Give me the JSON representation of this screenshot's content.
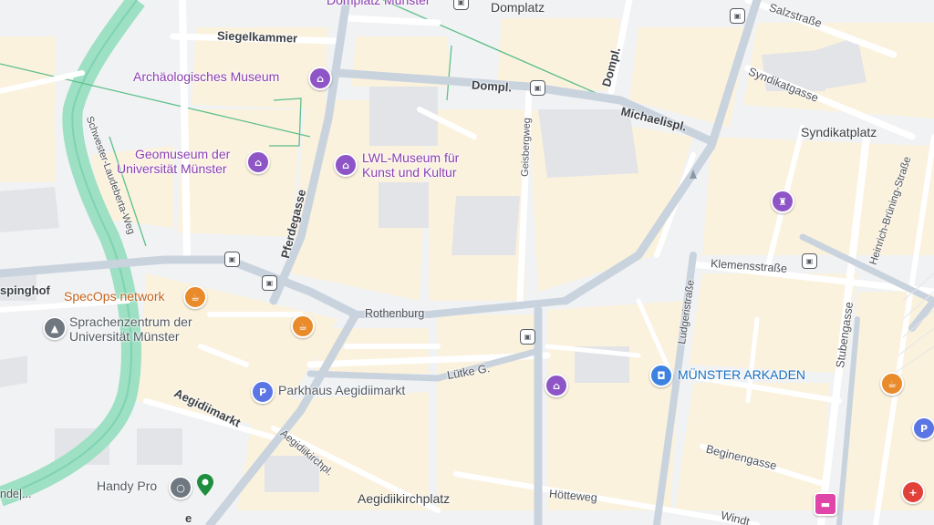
{
  "map": {
    "colors": {
      "background": "#f1f2f4",
      "block": "#fbf2de",
      "building": "#e3e5e8",
      "road": "#ffffff",
      "major_road": "#c9d3de",
      "river": "#9de0c4",
      "path": "#5cbf8a",
      "poi_purple": "#8e55c7",
      "poi_orange": "#e98a2b",
      "poi_blue": "#3d82e0"
    },
    "pois": {
      "domplatz_muenster": "Domplatz Münster",
      "domplatz": "Domplatz",
      "archaeologisches_museum": "Archäologisches Museum",
      "geomuseum_line1": "Geomuseum der",
      "geomuseum_line2": "Universität Münster",
      "lwl_line1": "LWL-Museum für",
      "lwl_line2": "Kunst und Kultur",
      "syndikatplatz": "Syndikatplatz",
      "specops": "SpecOps network",
      "sprachen_line1": "Sprachenzentrum der",
      "sprachen_line2": "Universität Münster",
      "parkhaus": "Parkhaus Aegidiimarkt",
      "muenster_arkaden": "MÜNSTER ARKADEN",
      "handy_pro": "Handy Pro",
      "aegidiikirchplatz": "Aegidiikirchplatz"
    },
    "streets": {
      "siegelkammer": "Siegelkammer",
      "dompl_1": "Dompl.",
      "dompl_2": "Dompl.",
      "michaelispl": "Michaelispl.",
      "salzstrasse": "Salzstraße",
      "syndikatgasse": "Syndikatgasse",
      "schwester": "Schwester-Laudeberta-Weg",
      "geisbergweg": "Geisbergweg",
      "pferdegasse": "Pferdegasse",
      "heinrich": "Heinrich-Brüning-Straße",
      "klemensstrasse": "Klemensstraße",
      "spinghof": "spinghof",
      "rothenburg": "Rothenburg",
      "ludgeristrasse": "Ludgeristraße",
      "stubengasse": "Stubengasse",
      "luetke": "Lütke G.",
      "aegidiimarkt": "Aegidiimarkt",
      "aegidiikirchpl": "Aegidiikirchpl.",
      "beginengasse": "Beginengasse",
      "hoetteweg": "Hötteweg",
      "windt": "Windt",
      "ende": "nde|...",
      "edge_e": "e"
    },
    "icons": {
      "museum": "museum-icon",
      "cafe": "cafe-icon",
      "school": "school-icon",
      "parking": "parking-icon",
      "shopping": "shopping-icon",
      "bus": "bus-stop-icon",
      "hotel": "hotel-icon",
      "hospital": "hospital-icon",
      "location": "location-pin-icon"
    }
  }
}
